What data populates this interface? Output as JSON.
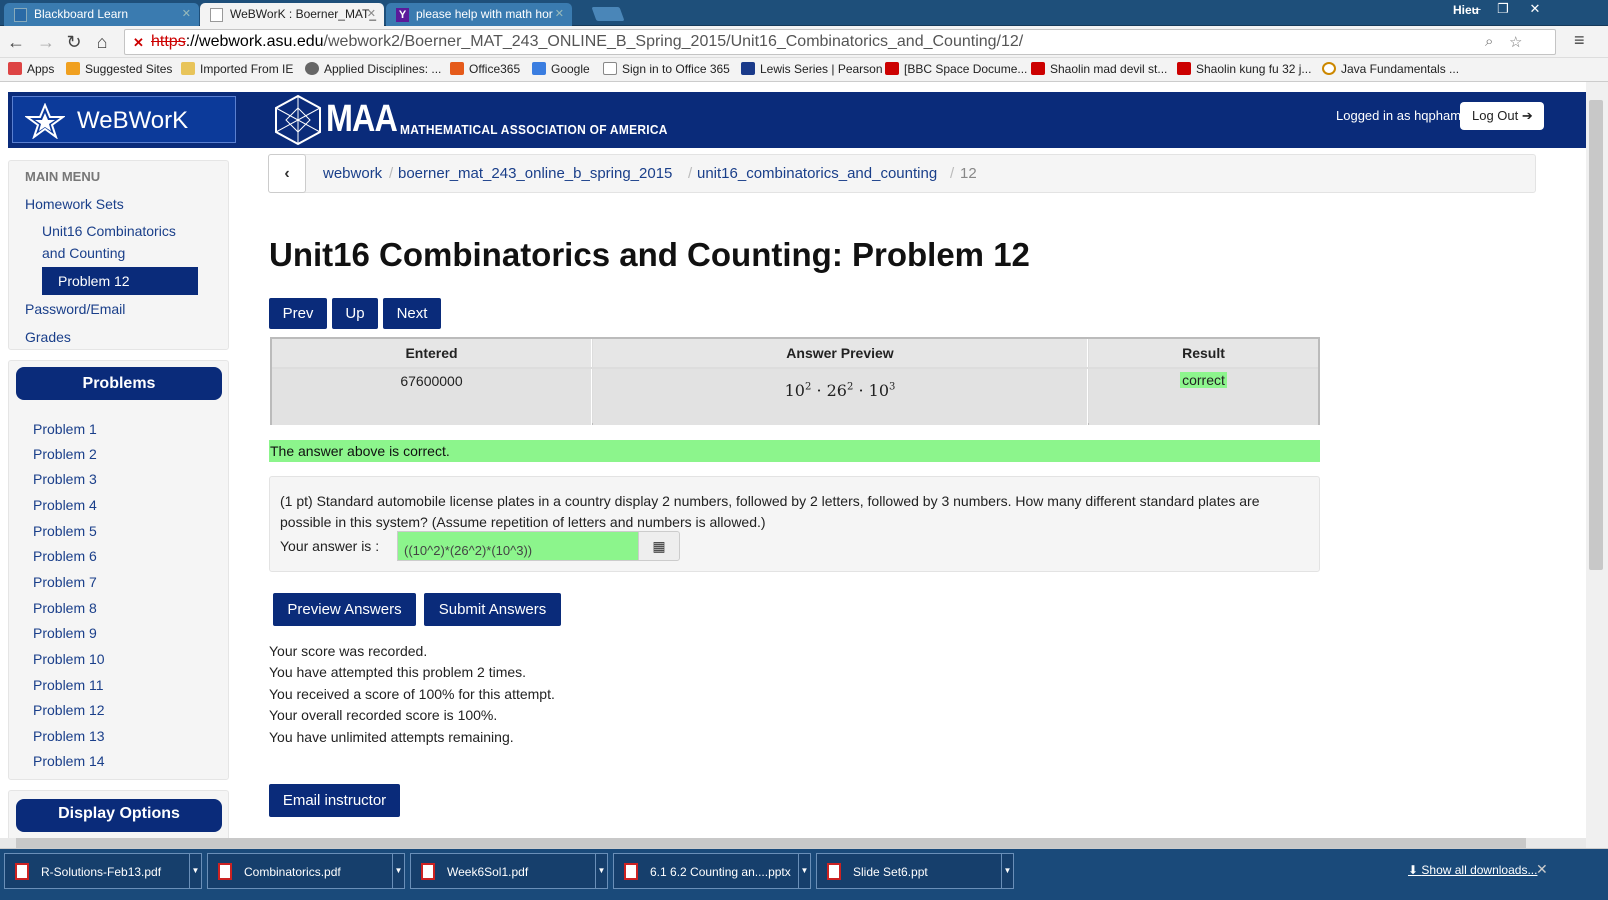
{
  "browser": {
    "tabs": [
      {
        "label": "Blackboard Learn",
        "active": false
      },
      {
        "label": "WeBWorK : Boerner_MAT_",
        "active": true
      },
      {
        "label": "please help with math hor",
        "active": false
      }
    ],
    "user": "Hieu",
    "url_scheme": "https",
    "url_host": "://webwork.asu.edu",
    "url_path": "/webwork2/Boerner_MAT_243_ONLINE_B_Spring_2015/Unit16_Combinatorics_and_Counting/12/",
    "bookmarks": [
      "Apps",
      "Suggested Sites",
      "Imported From IE",
      "Applied Disciplines: ...",
      "Office365",
      "Google",
      "Sign in to Office 365",
      "Lewis Series | Pearson",
      "[BBC Space Docume...",
      "Shaolin mad devil st...",
      "Shaolin kung fu 32 j...",
      "Java Fundamentals ..."
    ]
  },
  "header": {
    "brand": "WeBWorK",
    "maa_big": "MAA",
    "maa_sub": "MATHEMATICAL ASSOCIATION OF AMERICA",
    "logged_in": "Logged in as hqpham.",
    "logout": "Log Out"
  },
  "sidebar": {
    "main_menu": "MAIN MENU",
    "homework_sets": "Homework Sets",
    "unit_line1": "Unit16 Combinatorics",
    "unit_line2": "and Counting",
    "active_problem": "Problem 12",
    "password": "Password/Email",
    "grades": "Grades",
    "problems_header": "Problems",
    "problems": [
      "Problem 1",
      "Problem 2",
      "Problem 3",
      "Problem 4",
      "Problem 5",
      "Problem 6",
      "Problem 7",
      "Problem 8",
      "Problem 9",
      "Problem 10",
      "Problem 11",
      "Problem 12",
      "Problem 13",
      "Problem 14"
    ],
    "display_options": "Display Options"
  },
  "breadcrumb": {
    "items": [
      "webwork",
      "boerner_mat_243_online_b_spring_2015",
      "unit16_combinatorics_and_counting",
      "12"
    ]
  },
  "main": {
    "title": "Unit16 Combinatorics and Counting: Problem 12",
    "nav": {
      "prev": "Prev",
      "up": "Up",
      "next": "Next"
    },
    "results": {
      "headers": [
        "Entered",
        "Answer Preview",
        "Result"
      ],
      "entered": "67600000",
      "preview": {
        "a": "10",
        "a_exp": "2",
        "b": "26",
        "b_exp": "2",
        "c": "10",
        "c_exp": "3",
        "dot": "·"
      },
      "result": "correct"
    },
    "correct_message": "The answer above is correct.",
    "question": "(1 pt) Standard automobile license plates in a country display 2 numbers, followed by 2 letters, followed by 3 numbers. How many different standard plates are possible in this system? (Assume repetition of letters and numbers is allowed.)",
    "answer_label": "Your answer is :",
    "answer_value": "((10^2)*(26^2)*(10^3))",
    "preview_button": "Preview Answers",
    "submit_button": "Submit Answers",
    "status_lines": [
      "Your score was recorded.",
      "You have attempted this problem 2 times.",
      "You received a score of 100% for this attempt.",
      "Your overall recorded score is 100%.",
      "You have unlimited attempts remaining."
    ],
    "email_button": "Email instructor"
  },
  "downloads": {
    "items": [
      "R-Solutions-Feb13.pdf",
      "Combinatorics.pdf",
      "Week6Sol1.pdf",
      "6.1 6.2 Counting an....pptx",
      "Slide Set6.ppt"
    ],
    "show_all": "Show all downloads..."
  },
  "colors": {
    "nav_blue": "#0a2b7a",
    "correct_green": "#8cf58c",
    "tabstrip": "#1e4f7a"
  }
}
